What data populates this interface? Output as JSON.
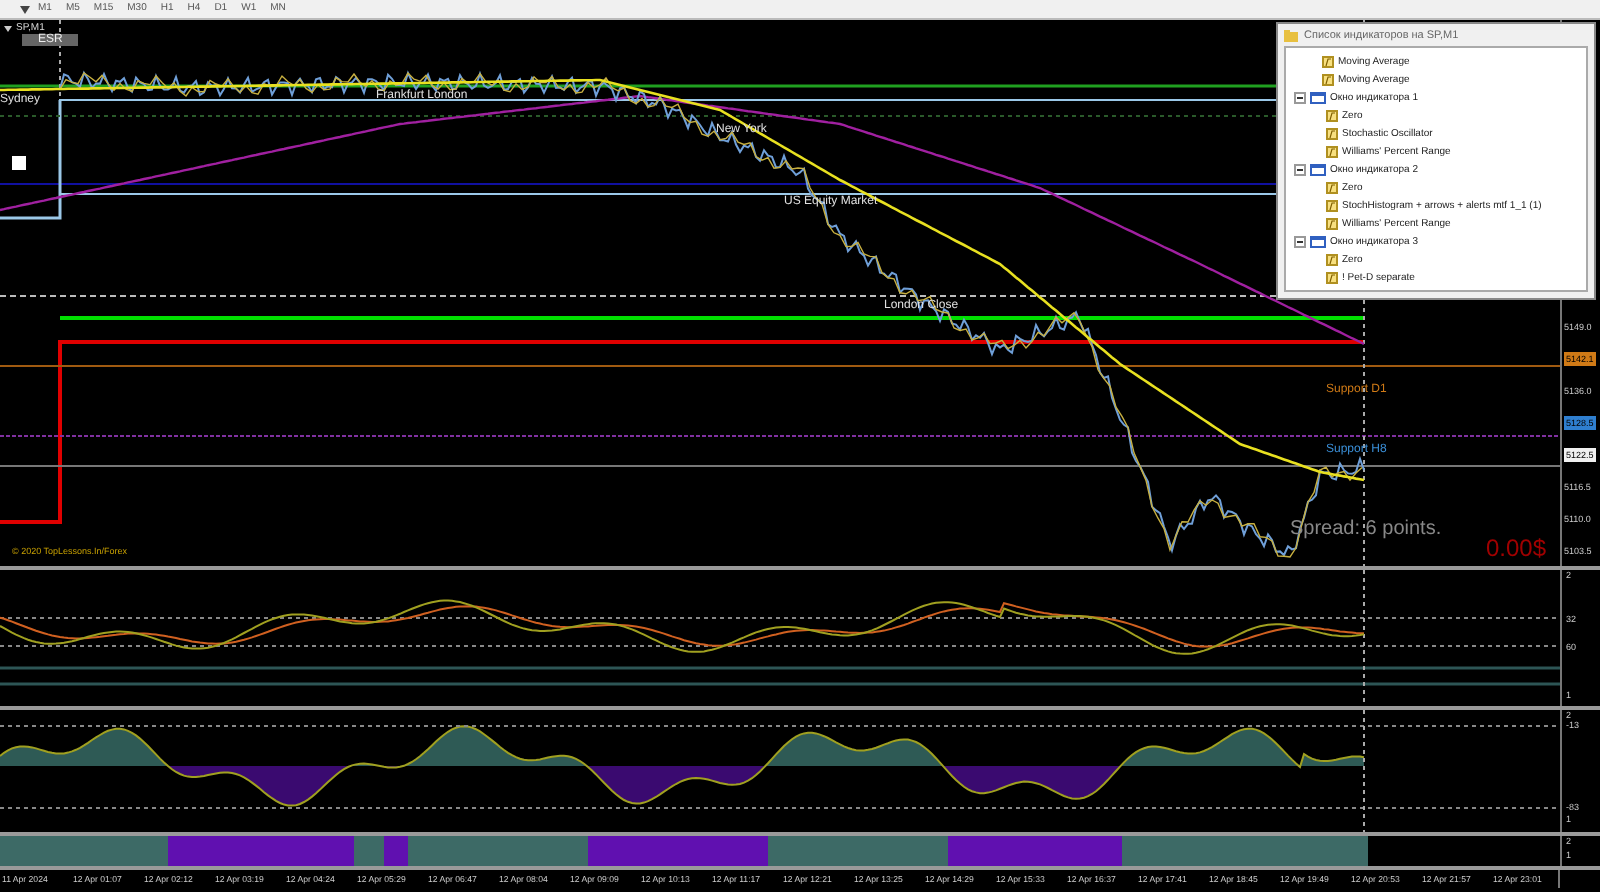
{
  "toolbar": {
    "timeframes": [
      "M1",
      "M5",
      "M15",
      "M30",
      "H1",
      "H4",
      "D1",
      "W1",
      "MN"
    ]
  },
  "chart": {
    "title": "SP,M1",
    "badge": "ESR",
    "copyright": "© 2020 TopLessons.In/Forex",
    "spread": "Spread: 6 points.",
    "profit": "0.00$",
    "labels": [
      {
        "text": "Sydney",
        "color": "#e0e0e0"
      },
      {
        "text": "Frankfurt London",
        "color": "#e0e0e0"
      },
      {
        "text": "New York",
        "color": "#e0e0e0"
      },
      {
        "text": "US Equity Market",
        "color": "#e0e0e0"
      },
      {
        "text": "London Close",
        "color": "#e0e0e0"
      },
      {
        "text": "Support D1",
        "color": "#d07a16"
      },
      {
        "text": "Support H8",
        "color": "#3a8fd8"
      }
    ]
  },
  "price_axis": [
    {
      "label": "5149.0"
    },
    {
      "label": "5142.1",
      "color": "#d07a16"
    },
    {
      "label": "5136.0"
    },
    {
      "label": "5128.5",
      "color": "#2f7fd0"
    },
    {
      "label": "5122.5",
      "color": "#f0f0f0"
    },
    {
      "label": "5116.5"
    },
    {
      "label": "5110.0"
    },
    {
      "label": "5103.5"
    }
  ],
  "pane_1_axis": [
    "2",
    "32",
    "60",
    "1"
  ],
  "pane_2_axis": [
    "2",
    "-13",
    "-83",
    "1"
  ],
  "pane_3_axis": [
    "2",
    "1"
  ],
  "time_axis": [
    "11 Apr 2024",
    "12 Apr 01:07",
    "12 Apr 02:12",
    "12 Apr 03:19",
    "12 Apr 04:24",
    "12 Apr 05:29",
    "12 Apr 06:47",
    "12 Apr 08:04",
    "12 Apr 09:09",
    "12 Apr 10:13",
    "12 Apr 11:17",
    "12 Apr 12:21",
    "12 Apr 13:25",
    "12 Apr 14:29",
    "12 Apr 15:33",
    "12 Apr 16:37",
    "12 Apr 17:41",
    "12 Apr 18:45",
    "12 Apr 19:49",
    "12 Apr 20:53",
    "12 Apr 21:57",
    "12 Apr 23:01"
  ],
  "indicator_list": {
    "title": "Список индикаторов на SP,M1",
    "items": [
      {
        "kind": "indicator",
        "label": "Moving Average"
      },
      {
        "kind": "indicator",
        "label": "Moving Average"
      },
      {
        "kind": "window",
        "label": "Окно индикатора 1",
        "expanded": true,
        "children": [
          {
            "kind": "indicator",
            "label": "Zero"
          },
          {
            "kind": "indicator",
            "label": "Stochastic Oscillator"
          },
          {
            "kind": "indicator",
            "label": "Williams' Percent Range"
          }
        ]
      },
      {
        "kind": "window",
        "label": "Окно индикатора 2",
        "expanded": true,
        "children": [
          {
            "kind": "indicator",
            "label": "Zero"
          },
          {
            "kind": "indicator",
            "label": "StochHistogram + arrows + alerts mtf 1_1 (1)"
          },
          {
            "kind": "indicator",
            "label": "Williams' Percent Range"
          }
        ]
      },
      {
        "kind": "window",
        "label": "Окно индикатора 3",
        "expanded": true,
        "children": [
          {
            "kind": "indicator",
            "label": "Zero"
          },
          {
            "kind": "indicator",
            "label": "! Pet-D separate"
          }
        ]
      }
    ]
  }
}
